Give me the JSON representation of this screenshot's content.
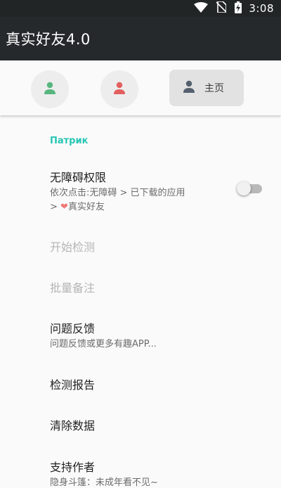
{
  "status_bar": {
    "time": "3:08"
  },
  "app_bar": {
    "title": "真实好友4.0"
  },
  "tabs": {
    "home_label": "主页"
  },
  "colors": {
    "accent": "#26c6b4",
    "tab_green": "#57b67f",
    "tab_red": "#e35f5f",
    "tab_home": "#54606e",
    "heart": "#f07878"
  },
  "settings": {
    "section_header": "Патрик",
    "accessibility": {
      "title": "无障碍权限",
      "summary_line1": "依次点击:无障碍 > 已下载的应用",
      "summary_prefix": "> ",
      "summary_suffix": "真实好友"
    },
    "start_detect": {
      "title": "开始检测"
    },
    "batch_note": {
      "title": "批量备注"
    },
    "feedback": {
      "title": "问题反馈",
      "summary": "问题反馈或更多有趣APP..."
    },
    "report": {
      "title": "检测报告"
    },
    "clear_data": {
      "title": "清除数据"
    },
    "support": {
      "title": "支持作者",
      "summary": "隐身斗篷：未成年看不见~"
    }
  }
}
